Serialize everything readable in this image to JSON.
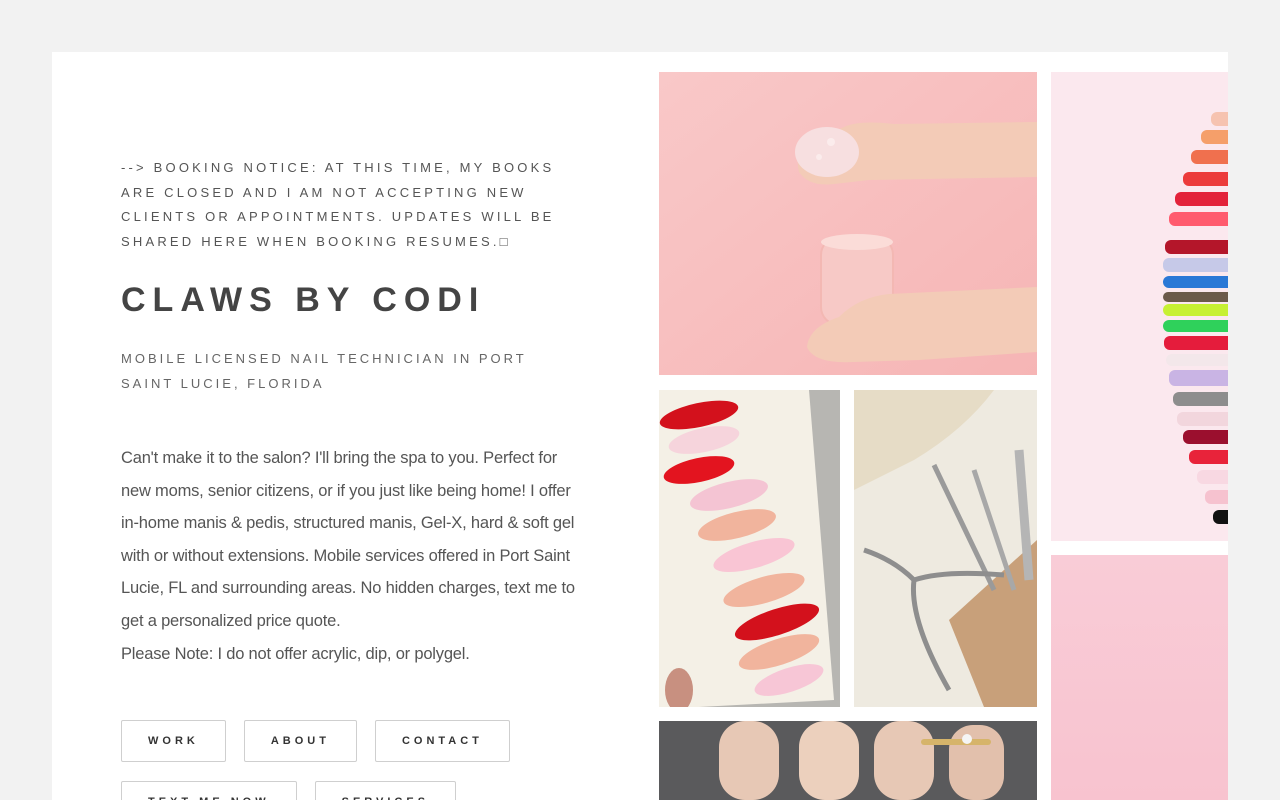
{
  "notice": "--> BOOKING NOTICE: AT THIS TIME, MY BOOKS ARE CLOSED AND I AM NOT ACCEPTING NEW CLIENTS OR APPOINTMENTS. UPDATES WILL BE SHARED HERE WHEN BOOKING RESUMES.□",
  "title": "CLAWS BY CODI",
  "subtitle": "MOBILE LICENSED NAIL TECHNICIAN IN PORT SAINT LUCIE, FLORIDA",
  "intro": {
    "text": "Can't make it to the salon? I'll bring the spa to you. Perfect for new moms, senior citizens, or if you just like being home! I offer in-home manis & pedis, structured manis, Gel-X, hard & soft gel with or without extensions. Mobile services offered in Port Saint Lucie, FL and surrounding areas. No hidden charges, text me to get a personalized price quote.",
    "note": "Please Note: I do not offer acrylic, dip, or polygel."
  },
  "buttons": {
    "work": "WORK",
    "about": "ABOUT",
    "contact": "CONTACT",
    "text_me_now": "TEXT ME NOW",
    "services": "SERVICES"
  },
  "gallery": [
    {
      "name": "hands-scrub-photo",
      "subject": "hands with pink sugar scrub jar"
    },
    {
      "name": "nail-swatch-wheel-photo",
      "subject": "fan of colorful nail swatches"
    },
    {
      "name": "valentine-nails-photo",
      "subject": "red and pink valentine nail tips"
    },
    {
      "name": "cuticle-tools-photo",
      "subject": "cuticle nipper and pushers"
    },
    {
      "name": "pink-backdrop-photo",
      "subject": "pink backdrop"
    },
    {
      "name": "manicured-hand-photo",
      "subject": "manicured hand with rings"
    }
  ]
}
